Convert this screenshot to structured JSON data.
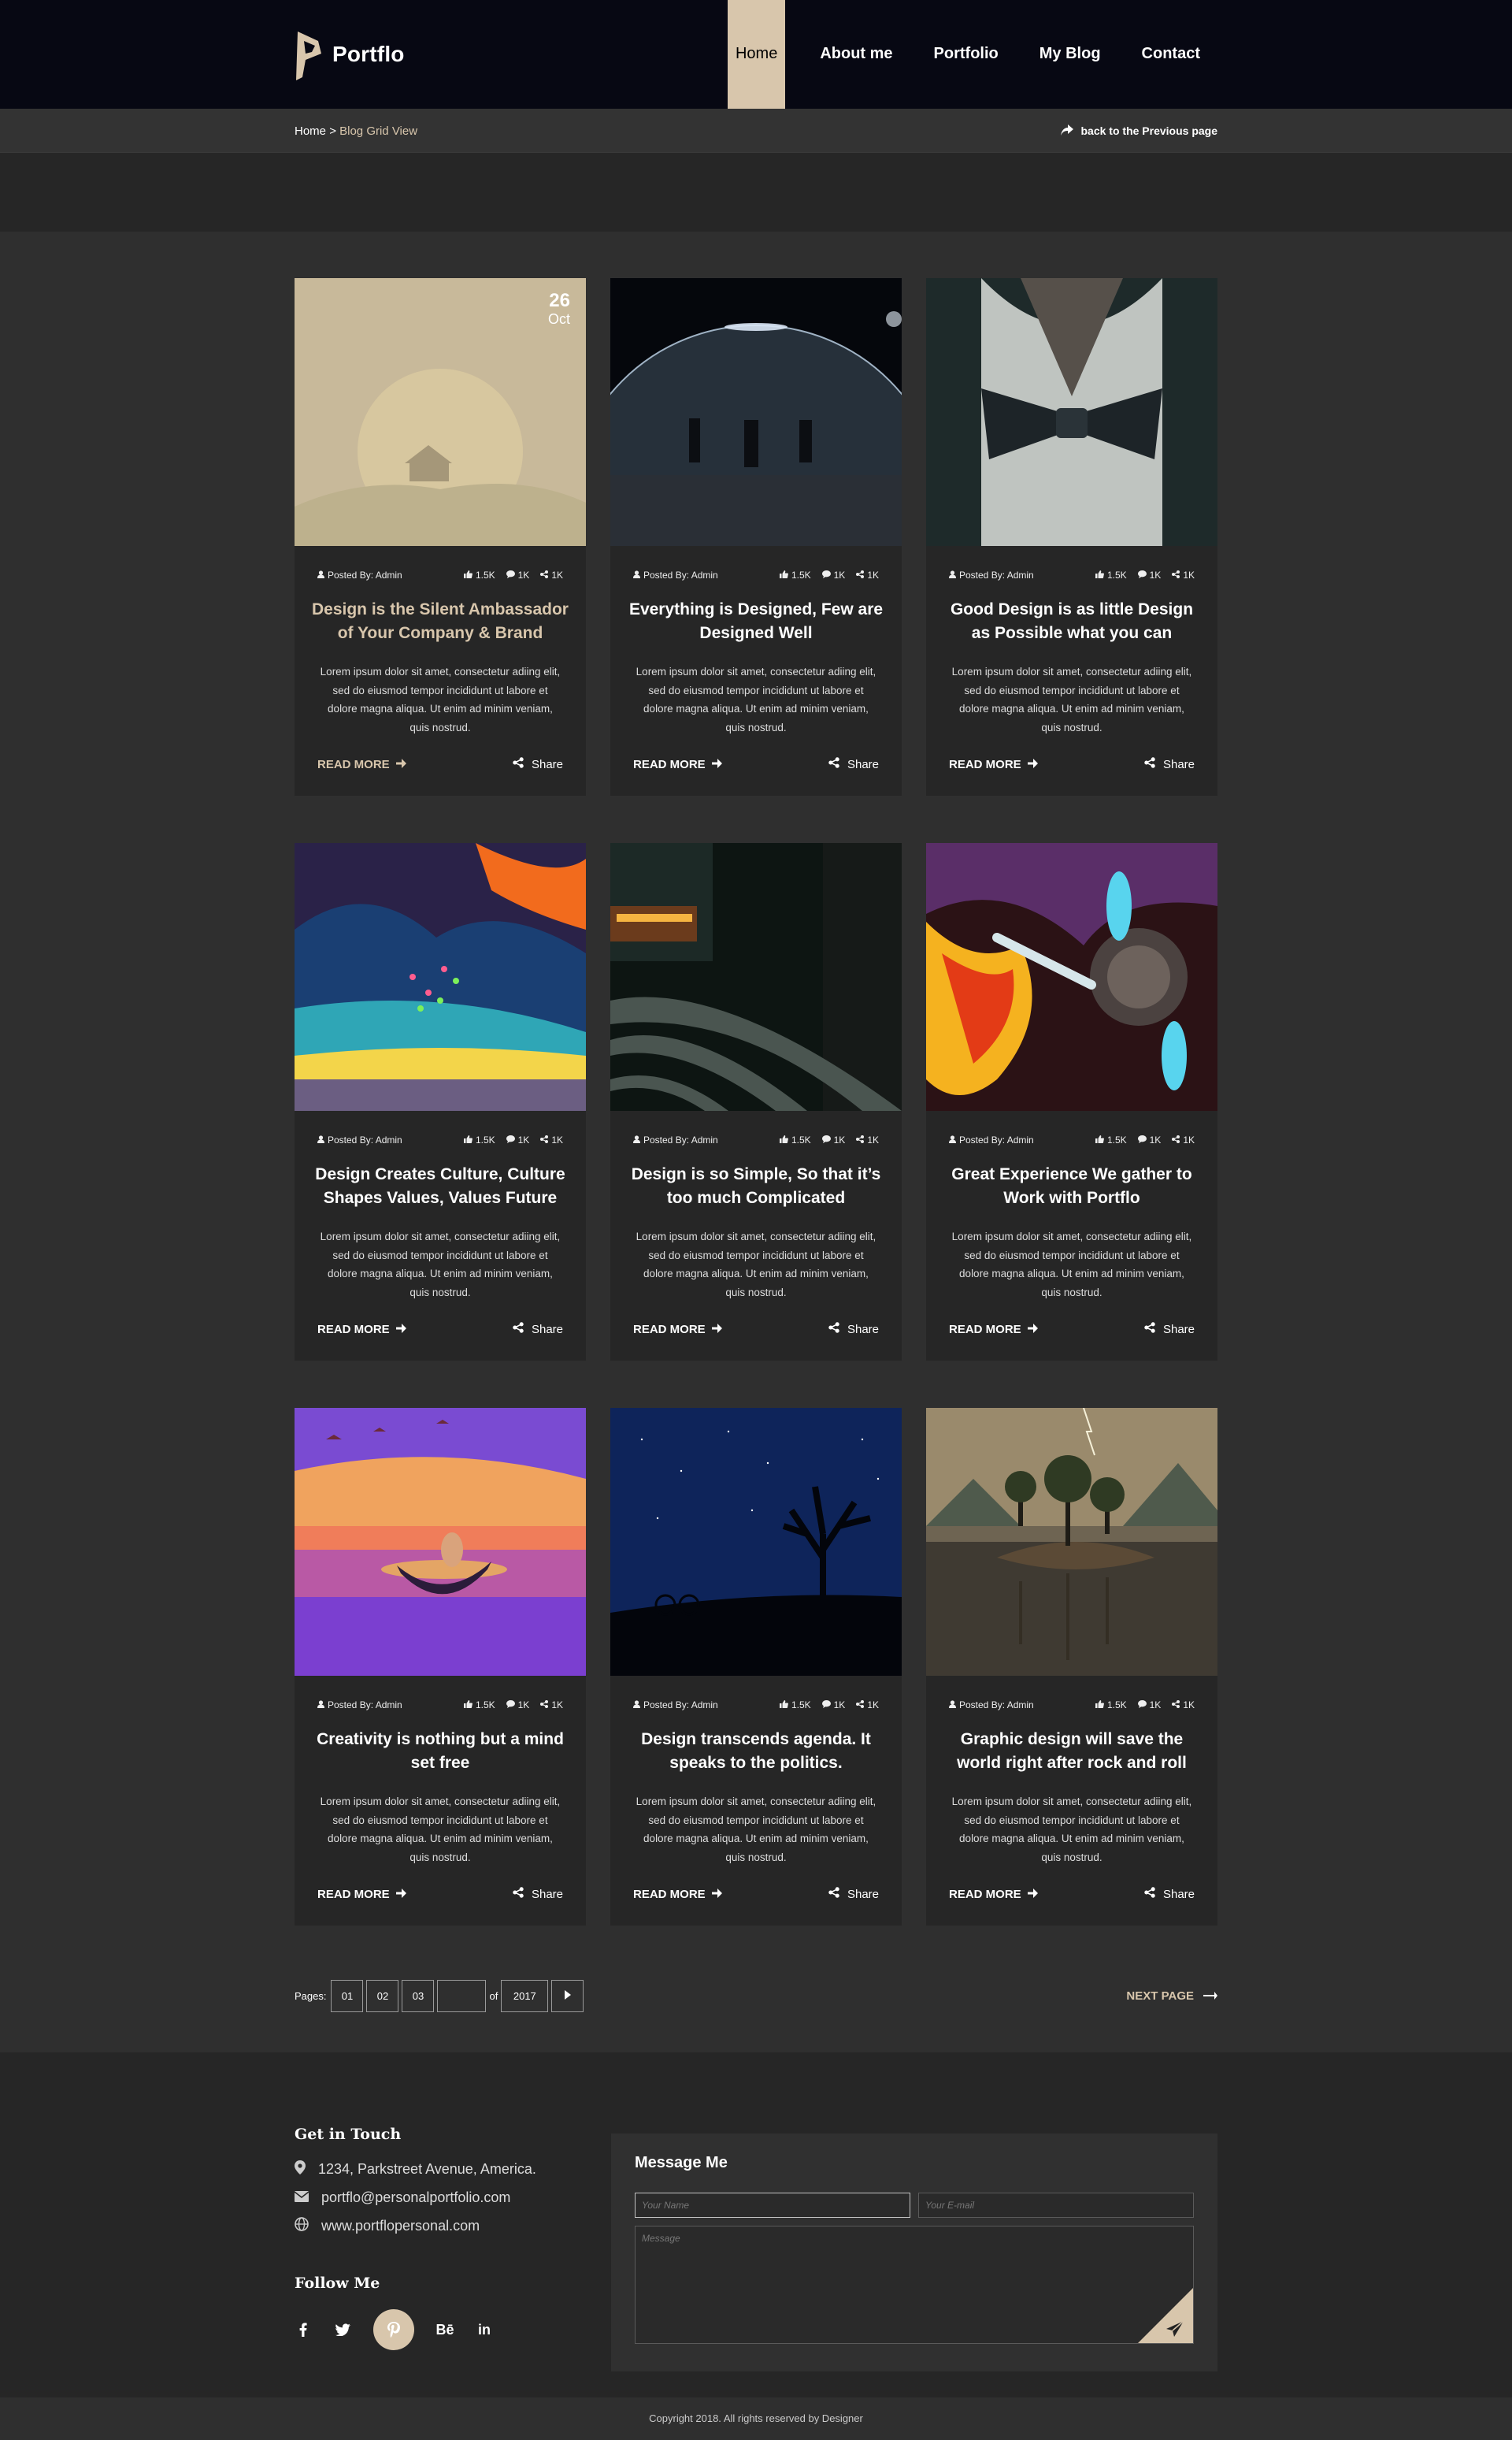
{
  "brand": {
    "name": "Portflo"
  },
  "nav": [
    {
      "label": "Home",
      "active": true
    },
    {
      "label": "About me",
      "active": false
    },
    {
      "label": "Portfolio",
      "active": false
    },
    {
      "label": "My Blog",
      "active": false
    },
    {
      "label": "Contact",
      "active": false
    }
  ],
  "breadcrumb": {
    "home": "Home",
    "separator": ">",
    "current": "Blog Grid View"
  },
  "back_link": "back to the Previous page",
  "colors": {
    "accent": "#d8c6ac",
    "header_bg": "#070813",
    "card_bg": "#262626",
    "page_bg": "#2f2f2f"
  },
  "posts": [
    {
      "date_day": "26",
      "date_month": "Oct",
      "author": "Posted By: Admin",
      "likes": "1.5K",
      "comments": "1K",
      "shares": "1K",
      "title": "Design is the Silent Ambassador of Your Company & Brand",
      "excerpt": "Lorem ipsum dolor sit amet, consectetur adiing elit, sed do eiusmod tempor incididunt ut labore et dolore magna aliqua. Ut enim ad minim veniam, quis nostrud.",
      "read_more": "READ MORE",
      "share": "Share"
    },
    {
      "author": "Posted By: Admin",
      "likes": "1.5K",
      "comments": "1K",
      "shares": "1K",
      "title": "Everything is Designed, Few are Designed Well",
      "excerpt": "Lorem ipsum dolor sit amet, consectetur adiing elit, sed do eiusmod tempor incididunt ut labore et dolore magna aliqua. Ut enim ad minim veniam, quis nostrud.",
      "read_more": "READ MORE",
      "share": "Share"
    },
    {
      "author": "Posted By: Admin",
      "likes": "1.5K",
      "comments": "1K",
      "shares": "1K",
      "title": "Good Design is as little Design as Possible what you can",
      "excerpt": "Lorem ipsum dolor sit amet, consectetur adiing elit, sed do eiusmod tempor incididunt ut labore et dolore magna aliqua. Ut enim ad minim veniam, quis nostrud.",
      "read_more": "READ MORE",
      "share": "Share"
    },
    {
      "author": "Posted By: Admin",
      "likes": "1.5K",
      "comments": "1K",
      "shares": "1K",
      "title": "Design Creates Culture, Culture Shapes Values, Values Future",
      "excerpt": "Lorem ipsum dolor sit amet, consectetur adiing elit, sed do eiusmod tempor incididunt ut labore et dolore magna aliqua. Ut enim ad minim veniam, quis nostrud.",
      "read_more": "READ MORE",
      "share": "Share"
    },
    {
      "author": "Posted By: Admin",
      "likes": "1.5K",
      "comments": "1K",
      "shares": "1K",
      "title": "Design is so Simple, So that it’s too much Complicated",
      "excerpt": "Lorem ipsum dolor sit amet, consectetur adiing elit, sed do eiusmod tempor incididunt ut labore et dolore magna aliqua. Ut enim ad minim veniam, quis nostrud.",
      "read_more": "READ MORE",
      "share": "Share"
    },
    {
      "author": "Posted By: Admin",
      "likes": "1.5K",
      "comments": "1K",
      "shares": "1K",
      "title": "Great Experience We gather to Work with Portflo",
      "excerpt": "Lorem ipsum dolor sit amet, consectetur adiing elit, sed do eiusmod tempor incididunt ut labore et dolore magna aliqua. Ut enim ad minim veniam, quis nostrud.",
      "read_more": "READ MORE",
      "share": "Share"
    },
    {
      "author": "Posted By: Admin",
      "likes": "1.5K",
      "comments": "1K",
      "shares": "1K",
      "title": "Creativity is nothing but a mind set free",
      "excerpt": "Lorem ipsum dolor sit amet, consectetur adiing elit, sed do eiusmod tempor incididunt ut labore et dolore magna aliqua. Ut enim ad minim veniam, quis nostrud.",
      "read_more": "READ MORE",
      "share": "Share"
    },
    {
      "author": "Posted By: Admin",
      "likes": "1.5K",
      "comments": "1K",
      "shares": "1K",
      "title": "Design transcends agenda. It speaks to the politics.",
      "excerpt": "Lorem ipsum dolor sit amet, consectetur adiing elit, sed do eiusmod tempor incididunt ut labore et dolore magna aliqua. Ut enim ad minim veniam, quis nostrud.",
      "read_more": "READ MORE",
      "share": "Share"
    },
    {
      "author": "Posted By: Admin",
      "likes": "1.5K",
      "comments": "1K",
      "shares": "1K",
      "title": "Graphic design will save the world right after rock and roll",
      "excerpt": "Lorem ipsum dolor sit amet, consectetur adiing elit, sed do eiusmod tempor incididunt ut labore et dolore magna aliqua. Ut enim ad minim veniam, quis nostrud.",
      "read_more": "READ MORE",
      "share": "Share"
    }
  ],
  "pagination": {
    "label": "Pages:",
    "pages": [
      "01",
      "02",
      "03"
    ],
    "current_value": "",
    "of_label": "of",
    "total": "2017",
    "next_label": "NEXT PAGE"
  },
  "footer": {
    "contact_heading": "Get in Touch",
    "address": "1234, Parkstreet Avenue, America.",
    "email": "portflo@personalportfolio.com",
    "website": "www.portflopersonal.com",
    "follow_heading": "Follow Me",
    "social_icons": [
      "facebook-icon",
      "twitter-icon",
      "pinterest-icon",
      "behance-icon",
      "linkedin-icon"
    ],
    "message_heading": "Message Me",
    "name_placeholder": "Your Name",
    "email_placeholder": "Your E-mail",
    "message_placeholder": "Message",
    "copyright": "Copyright 2018. All rights reserved by Designer"
  }
}
